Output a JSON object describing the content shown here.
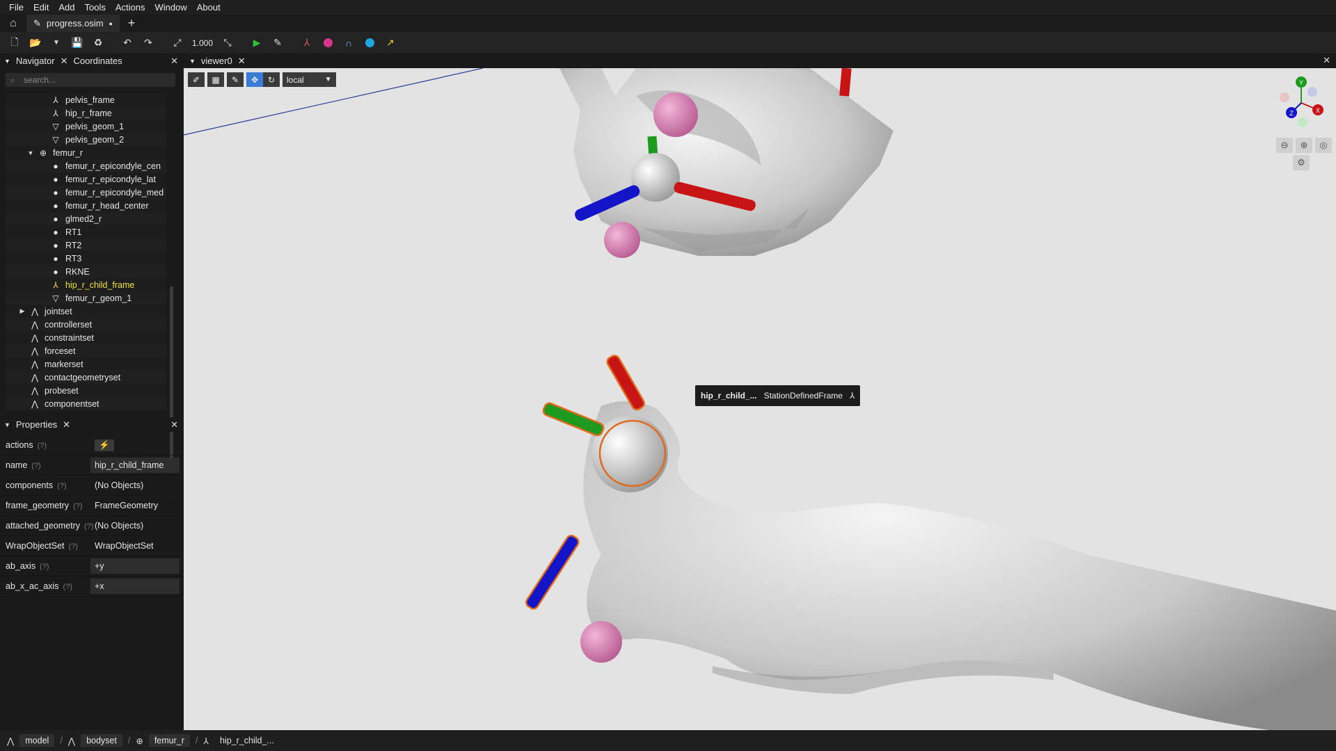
{
  "menu": [
    "File",
    "Edit",
    "Add",
    "Tools",
    "Actions",
    "Window",
    "About"
  ],
  "tabs": {
    "active_tab": "progress.osim",
    "modified_dot": "●",
    "add": "+"
  },
  "toolbar": {
    "scale_value": "1.000"
  },
  "navigator": {
    "tab1": "Navigator",
    "tab2": "Coordinates",
    "close": "✕",
    "search_placeholder": "search...",
    "items": [
      {
        "label": "pelvis_frame"
      },
      {
        "label": "hip_r_frame"
      },
      {
        "label": "pelvis_geom_1"
      },
      {
        "label": "pelvis_geom_2"
      },
      {
        "label": "femur_r"
      },
      {
        "label": "femur_r_epicondyle_cen"
      },
      {
        "label": "femur_r_epicondyle_lat"
      },
      {
        "label": "femur_r_epicondyle_med"
      },
      {
        "label": "femur_r_head_center"
      },
      {
        "label": "glmed2_r"
      },
      {
        "label": "RT1"
      },
      {
        "label": "RT2"
      },
      {
        "label": "RT3"
      },
      {
        "label": "RKNE"
      },
      {
        "label": "hip_r_child_frame"
      },
      {
        "label": "femur_r_geom_1"
      },
      {
        "label": "jointset"
      },
      {
        "label": "controllerset"
      },
      {
        "label": "constraintset"
      },
      {
        "label": "forceset"
      },
      {
        "label": "markerset"
      },
      {
        "label": "contactgeometryset"
      },
      {
        "label": "probeset"
      },
      {
        "label": "componentset"
      }
    ]
  },
  "properties": {
    "title": "Properties",
    "help_mark": "(?)",
    "rows": [
      {
        "key": "actions",
        "value": "⚡"
      },
      {
        "key": "name",
        "value": "hip_r_child_frame"
      },
      {
        "key": "components",
        "value": "(No Objects)"
      },
      {
        "key": "frame_geometry",
        "value": "FrameGeometry"
      },
      {
        "key": "attached_geometry",
        "value": "(No Objects)"
      },
      {
        "key": "WrapObjectSet",
        "value": "WrapObjectSet"
      },
      {
        "key": "ab_axis",
        "value": "+y"
      },
      {
        "key": "ab_x_ac_axis",
        "value": "+x"
      }
    ]
  },
  "viewer": {
    "title": "viewer0",
    "frame_mode": "local",
    "tooltip_name": "hip_r_child_...",
    "tooltip_type": "StationDefinedFrame",
    "axis_labels": {
      "y": "Y",
      "x": "X",
      "z": "Z"
    },
    "colors": {
      "x_axis": "#c81414",
      "y_axis": "#1e9a1e",
      "z_axis": "#1414c8",
      "marker": "#d97cb3",
      "highlight": "#e06a1c"
    }
  },
  "breadcrumb": [
    "model",
    "bodyset",
    "femur_r",
    "hip_r_child_..."
  ]
}
